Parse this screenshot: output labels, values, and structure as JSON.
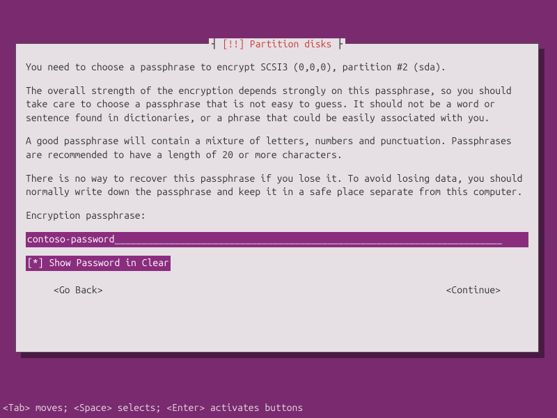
{
  "dialog": {
    "title_prefix": "┤ ",
    "title_marker": "[!!]",
    "title_text": "Partition disks",
    "title_suffix": " ├",
    "para1": "You need to choose a passphrase to encrypt SCSI3 (0,0,0), partition #2 (sda).",
    "para2": "The overall strength of the encryption depends strongly on this passphrase, so you should take care to choose a passphrase that is not easy to guess. It should not be a word or sentence found in dictionaries, or a phrase that could be easily associated with you.",
    "para3": "A good passphrase will contain a mixture of letters, numbers and punctuation. Passphrases are recommended to have a length of 20 or more characters.",
    "para4": "There is no way to recover this passphrase if you lose it. To avoid losing data, you should normally write down the passphrase and keep it in a safe place separate from this computer.",
    "field_label": "Encryption passphrase:",
    "input_value": "contoso-password",
    "input_pad": "_______________________________________________________________________",
    "checkbox_mark": "[*]",
    "checkbox_label": "Show Password in Clear",
    "go_back_label": "<Go Back>",
    "continue_label": "<Continue>"
  },
  "footer": "<Tab> moves; <Space> selects; <Enter> activates buttons"
}
